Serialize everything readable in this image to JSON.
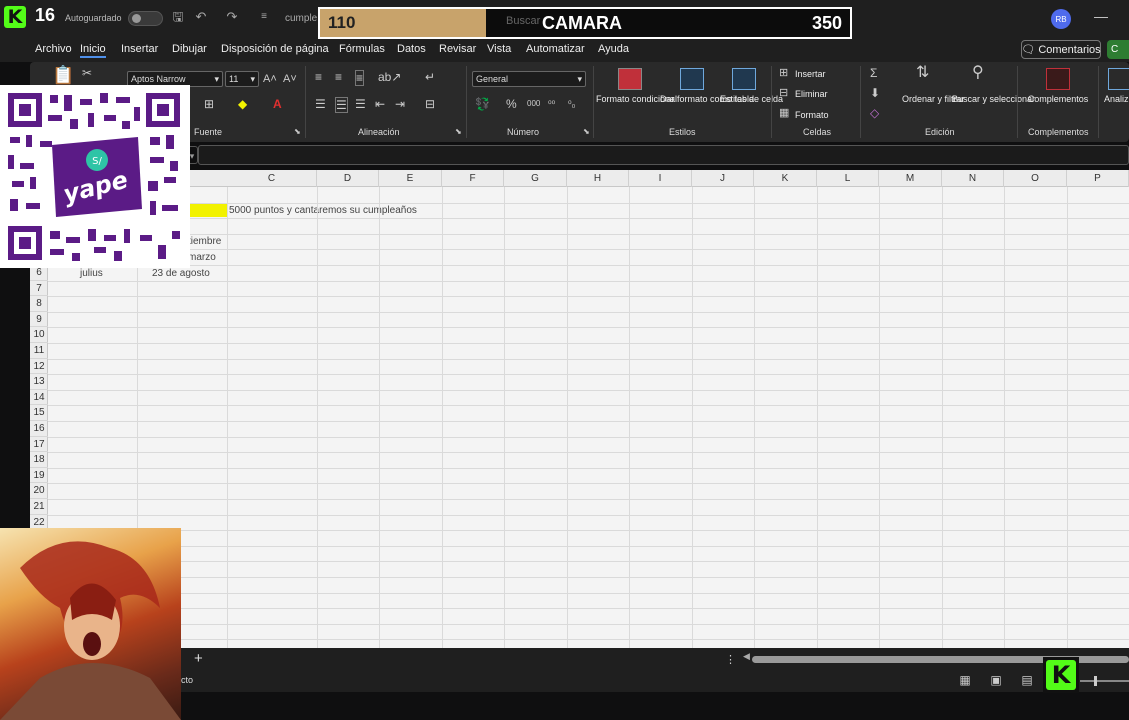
{
  "titlebar": {
    "stream_counter": "16",
    "autosave_label": "Autoguardado",
    "file_name": "cumple",
    "avatar_initials": "RB"
  },
  "goal_overlay": {
    "current": "110",
    "label": "CAMARA",
    "goal": "350",
    "search_placeholder": "Buscar",
    "progress_fraction": 0.314
  },
  "menu": {
    "tabs": [
      "Archivo",
      "Inicio",
      "Insertar",
      "Dibujar",
      "Disposición de página",
      "Fórmulas",
      "Datos",
      "Revisar",
      "Vista",
      "Automatizar",
      "Ayuda"
    ],
    "comments_label": "Comentarios",
    "share_label": "C"
  },
  "ribbon": {
    "font_name": "Aptos Narrow",
    "font_size": "11",
    "number_format": "General",
    "groups": {
      "fuente": "Fuente",
      "alineacion": "Alineación",
      "numero": "Número",
      "estilos": "Estilos",
      "celdas": "Celdas",
      "edicion": "Edición",
      "complementos": "Complementos"
    },
    "buttons": {
      "formato_condicional": "Formato condicional",
      "dar_formato_tabla": "Dar formato como tabla",
      "estilos_celda": "Estilos de celda",
      "insertar": "Insertar",
      "eliminar": "Eliminar",
      "formato": "Formato",
      "ordenar_filtrar": "Ordenar y filtrar",
      "buscar_seleccionar": "Buscar y seleccionar",
      "complementos": "Complementos",
      "analizar": "Analiz datos"
    }
  },
  "grid": {
    "columns": [
      "C",
      "D",
      "E",
      "F",
      "G",
      "H",
      "I",
      "J",
      "K",
      "L",
      "M",
      "N",
      "O",
      "P"
    ],
    "rows": [
      "6",
      "7",
      "8",
      "9",
      "10",
      "11",
      "12",
      "13",
      "14",
      "15",
      "16",
      "17",
      "18",
      "19",
      "20",
      "21",
      "22"
    ],
    "cells": {
      "c2": "5000 puntos y cantaremos su cumpleaños",
      "b4": "tiembre",
      "b5": "marzo",
      "a6": "julius",
      "b6": "23 de agosto"
    }
  },
  "statusbar": {
    "status_text": "ecto",
    "add_sheet": "+"
  },
  "overlays": {
    "qr_brand": "yape",
    "kick_logo": "K"
  }
}
